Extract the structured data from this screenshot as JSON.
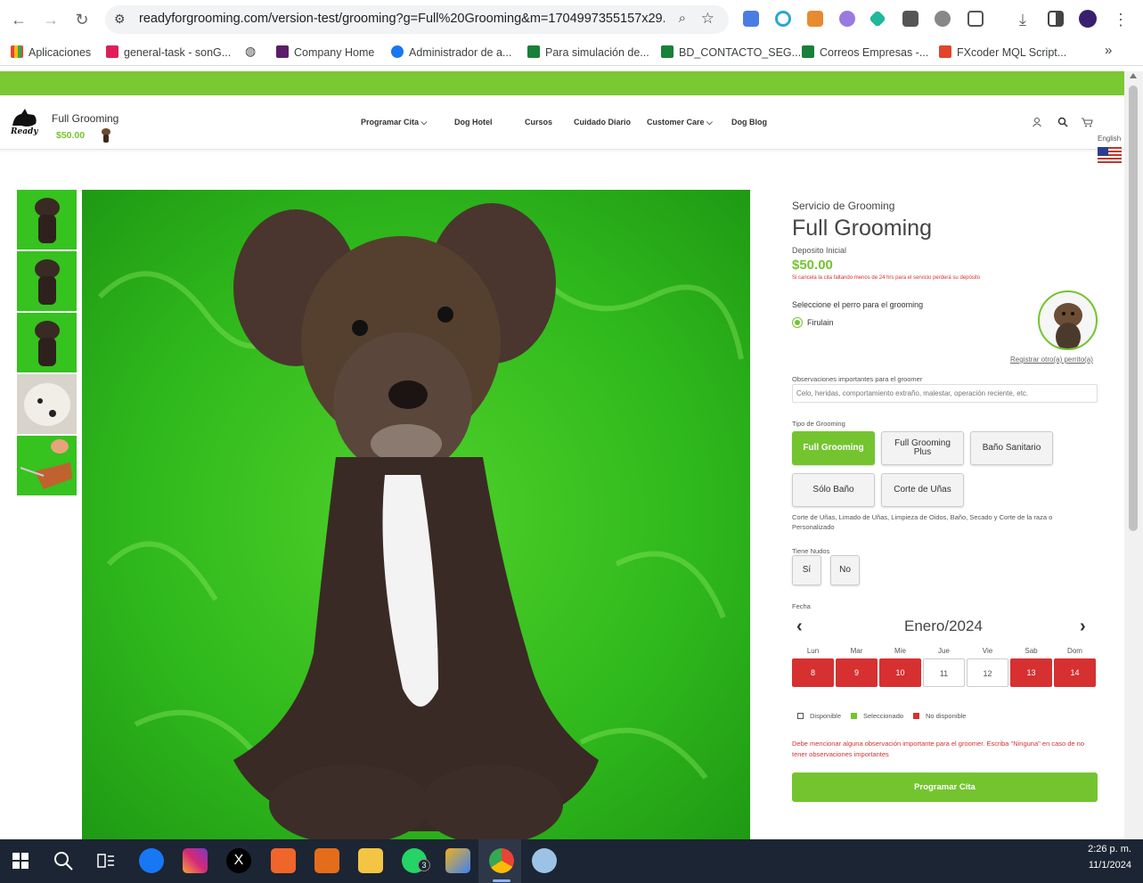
{
  "browser": {
    "url": "readyforgrooming.com/version-test/grooming?g=Full%20Grooming&m=1704997355157x29...",
    "bookmarks": [
      "Aplicaciones",
      "general-task - sonG...",
      "Company Home",
      "Administrador de a...",
      "Para simulación de...",
      "BD_CONTACTO_SEG...",
      "Correos Empresas -...",
      "FXcoder MQL Script..."
    ]
  },
  "header": {
    "cart_title": "Full Grooming",
    "cart_price": "$50.00",
    "nav": [
      "Programar Cita",
      "Dog Hotel",
      "Cursos",
      "Cuidado Diario",
      "Customer Care",
      "Dog Blog"
    ],
    "language": "English"
  },
  "product": {
    "category": "Servicio de Grooming",
    "title": "Full Grooming",
    "deposit_label": "Deposito Inicial",
    "price": "$50.00",
    "cancel_note": "Si cancela la cita faltando menos de 24 hrs para el servicio perderá su depósito",
    "select_dog_label": "Seleccione el perro para el grooming",
    "dog_name": "Firulain",
    "register_link": "Registrar otro(a) perrito(a)",
    "observations_label": "Observaciones importantes para el groomer",
    "observations_placeholder": "Celo, heridas, comportamiento extraño, malestar, operación reciente, etc.",
    "type_label": "Tipo de Grooming",
    "types": [
      "Full Grooming",
      "Full Grooming Plus",
      "Baño Sanitario",
      "Sólo Baño",
      "Corte de Uñas"
    ],
    "type_desc": "Corte de Uñas, Limado de Uñas, Limpieza de Oidos, Baño, Secado y Corte de la raza o Personalizado",
    "knots_label": "Tiene Nudos",
    "knots_options": [
      "Sí",
      "No"
    ],
    "date_label": "Fecha",
    "month": "Enero/2024",
    "weekdays": [
      "Lun",
      "Mar",
      "Mie",
      "Jue",
      "Vie",
      "Sab",
      "Dom"
    ],
    "days": [
      "8",
      "9",
      "10",
      "11",
      "12",
      "13",
      "14"
    ],
    "legend": [
      "Disponible",
      "Seleccionado",
      "No disponible"
    ],
    "error_msg": "Debe mencionar alguna observación importante para el groomer. Escriba \"Ninguna\" en caso de no tener observaciones importantes",
    "submit": "Programar Cita"
  },
  "taskbar": {
    "time": "2:26 p. m.",
    "date": "11/1/2024",
    "whatsapp_badge": "3"
  },
  "colors": {
    "brand_green": "#74c42f",
    "unavailable_red": "#d63031"
  }
}
